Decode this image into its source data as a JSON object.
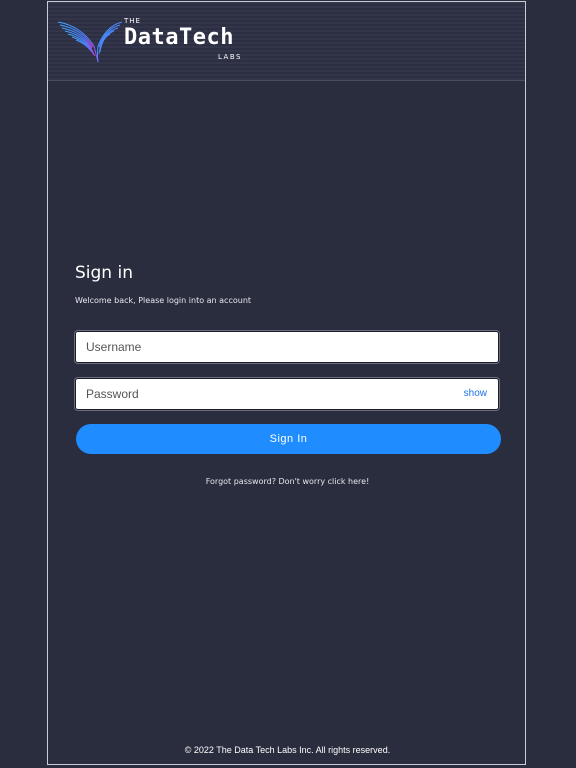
{
  "brand": {
    "the": "THE",
    "name": "DataTech",
    "labs": "LABS",
    "colors": {
      "mark_start": "#3fa3ff",
      "mark_end": "#c13fd8"
    }
  },
  "login": {
    "title": "Sign in",
    "subtitle": "Welcome back, Please login into an account",
    "username_placeholder": "Username",
    "username_value": "",
    "password_placeholder": "Password",
    "password_value": "",
    "show_label": "show",
    "signin_label": "Sign In",
    "forgot_label": "Forgot password? Don't worry click here!"
  },
  "footer": {
    "copyright": "© 2022 The Data Tech Labs Inc. All rights reserved."
  },
  "theme": {
    "background": "#2a2d3e",
    "accent": "#1f8cff",
    "link": "#1a73e8"
  }
}
